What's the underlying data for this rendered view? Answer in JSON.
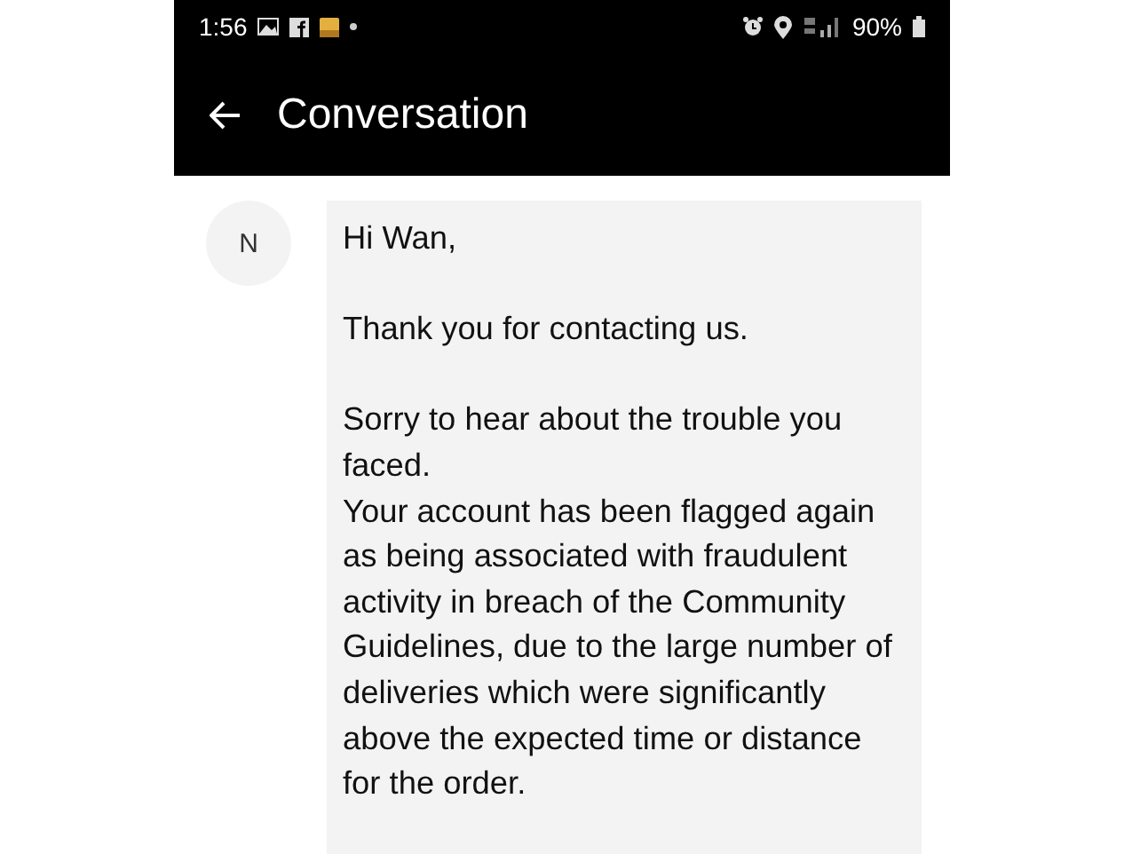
{
  "status_bar": {
    "time": "1:56",
    "battery": "90%"
  },
  "app_bar": {
    "title": "Conversation"
  },
  "message": {
    "avatar": "N",
    "paragraphs": [
      [
        "Hi Wan,"
      ],
      [
        "Thank you for contacting us."
      ],
      [
        "Sorry to hear about the trouble you faced.",
        "Your account has been flagged again as being associated with fraudulent activity in breach of the Community Guidelines, due to the large number of deliveries which were significantly above the expected time or distance for the order."
      ]
    ]
  }
}
